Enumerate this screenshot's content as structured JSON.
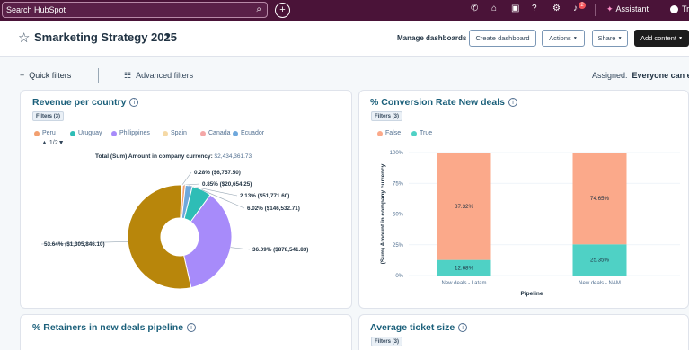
{
  "topnav": {
    "search_placeholder": "Search HubSpot",
    "notification_count": "2",
    "assistant_label": "Assistant",
    "user_initials": "Tr"
  },
  "header": {
    "title": "Smarketing Strategy 2025",
    "manage_dashboards": "Manage dashboards",
    "create_dashboard": "Create dashboard",
    "actions": "Actions",
    "share": "Share",
    "add_content": "Add content"
  },
  "filters": {
    "quick_filters": "Quick filters",
    "advanced_filters": "Advanced filters",
    "assigned_label": "Assigned:",
    "assigned_value": "Everyone can edit"
  },
  "cards": {
    "revenue": {
      "title": "Revenue per country",
      "filter_chip": "Filters (3)",
      "pager": "1/2",
      "total_label": "Total (Sum) Amount in company currency:",
      "total_value": "$2,434,361.73"
    },
    "conversion": {
      "title": "% Conversion Rate New deals",
      "filter_chip": "Filters (3)"
    },
    "retainers": {
      "title": "% Retainers in new deals pipeline"
    },
    "ticket": {
      "title": "Average ticket size",
      "filter_chip": "Filters (3)"
    }
  },
  "chart_data": [
    {
      "type": "pie",
      "title": "Revenue per country",
      "categories": [
        "Peru",
        "Uruguay",
        "Philippines",
        "Spain",
        "Canada",
        "Ecuador"
      ],
      "colors": [
        "#f2a070",
        "#2ebdb6",
        "#a78bfa",
        "#f5d9a6",
        "#f4a7a7",
        "#6fa8dc"
      ],
      "slices": [
        {
          "label": "0.28% ($6,757.50)",
          "value": 6757.5,
          "percent": 0.28
        },
        {
          "label": "0.85% ($20,654.25)",
          "value": 20654.25,
          "percent": 0.85
        },
        {
          "label": "2.13% ($51,771.60)",
          "value": 51771.6,
          "percent": 2.13
        },
        {
          "label": "6.02% ($146,532.71)",
          "value": 146532.71,
          "percent": 6.02
        },
        {
          "label": "36.09% ($878,541.83)",
          "value": 878541.83,
          "percent": 36.09
        },
        {
          "label": "53.64% ($1,305,846.10)",
          "value": 1305846.1,
          "percent": 53.64
        }
      ],
      "slice_colors": [
        "#f4a7a7",
        "#f2a070",
        "#6fa8dc",
        "#2ebdb6",
        "#a78bfa",
        "#b8860b"
      ]
    },
    {
      "type": "bar",
      "title": "% Conversion Rate New deals",
      "categories": [
        "New deals - Latam",
        "New deals - NAM"
      ],
      "series": [
        {
          "name": "False",
          "values": [
            87.32,
            74.65
          ],
          "labels": [
            "87.32%",
            "74.65%"
          ],
          "color": "#fba98a"
        },
        {
          "name": "True",
          "values": [
            12.68,
            25.35
          ],
          "labels": [
            "12.68%",
            "25.35%"
          ],
          "color": "#4fd1c5"
        }
      ],
      "y_ticks": [
        "100%",
        "75%",
        "50%",
        "25%",
        "0%"
      ],
      "ylim": [
        0,
        100
      ],
      "xlabel": "Pipeline",
      "ylabel": "(Sum) Amount in company currency",
      "stacked": true
    }
  ]
}
